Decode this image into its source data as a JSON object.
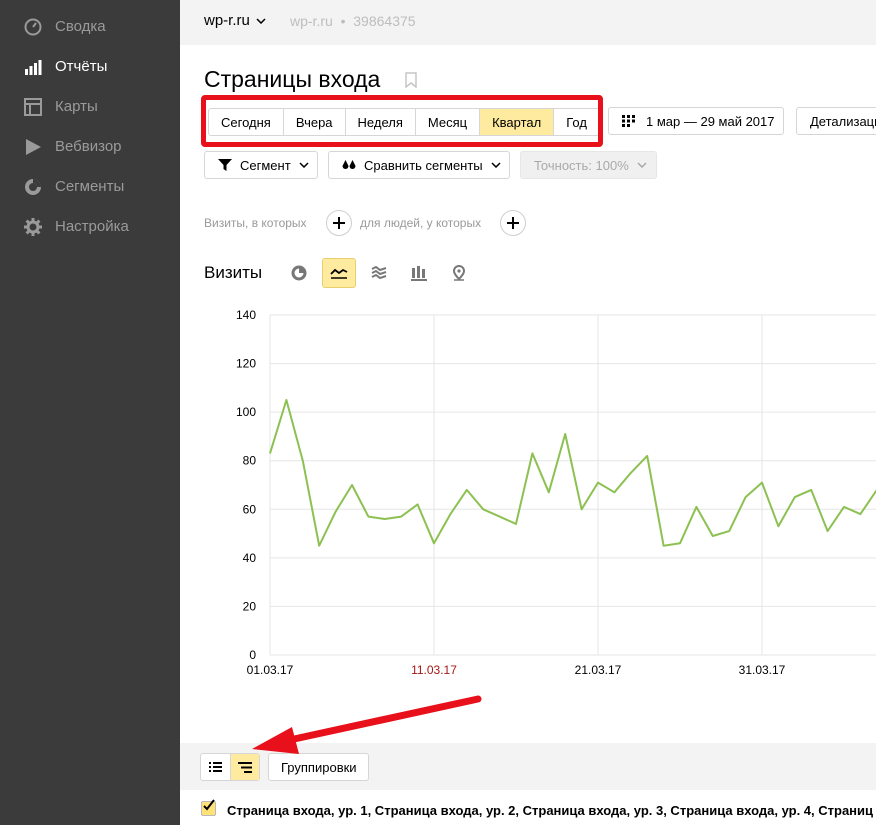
{
  "sidebar": {
    "items": [
      {
        "label": "Сводка",
        "icon": "gauge-icon",
        "active": false
      },
      {
        "label": "Отчёты",
        "icon": "bar-chart-icon",
        "active": true
      },
      {
        "label": "Карты",
        "icon": "map-layout-icon",
        "active": false
      },
      {
        "label": "Вебвизор",
        "icon": "play-icon",
        "active": false
      },
      {
        "label": "Сегменты",
        "icon": "pie-ring-icon",
        "active": false
      },
      {
        "label": "Настройка",
        "icon": "gear-icon",
        "active": false
      }
    ]
  },
  "topbar": {
    "site": "wp-r.ru",
    "site_secondary": "wp-r.ru",
    "separator": "•",
    "counter_id": "39864375"
  },
  "page": {
    "title": "Страницы входа"
  },
  "periods": {
    "items": [
      "Сегодня",
      "Вчера",
      "Неделя",
      "Месяц",
      "Квартал",
      "Год"
    ],
    "selected": "Квартал"
  },
  "toolbar": {
    "date_range": "1 мар — 29 май 2017",
    "detail": "Детализаци",
    "segment": "Сегмент",
    "compare": "Сравнить сегменты",
    "accuracy": "Точность: 100%"
  },
  "filters": {
    "visits_where": "Визиты, в которых",
    "people_where": "для людей, у которых"
  },
  "chart_section": {
    "label": "Визиты"
  },
  "chart_data": {
    "type": "line",
    "ylim": [
      0,
      140
    ],
    "yticks": [
      0,
      20,
      40,
      60,
      80,
      100,
      120,
      140
    ],
    "xticks": [
      "01.03.17",
      "11.03.17",
      "21.03.17",
      "31.03.17"
    ],
    "weekend_ticks": [
      "11.03.17"
    ],
    "series": [
      {
        "color": "#8cc152",
        "values": [
          83,
          105,
          80,
          45,
          59,
          70,
          57,
          56,
          57,
          62,
          46,
          58,
          68,
          60,
          57,
          54,
          83,
          67,
          91,
          60,
          71,
          67,
          75,
          82,
          45,
          46,
          61,
          49,
          51,
          65,
          71,
          53,
          65,
          68,
          51,
          61,
          58,
          68
        ]
      }
    ],
    "grid": true
  },
  "bottom": {
    "grouping_button": "Группировки",
    "grouping_text": "Страница входа, ур. 1, Страница входа, ур. 2, Страница входа, ур. 3, Страница входа, ур. 4, Страниц"
  },
  "colors": {
    "accent": "#ffeba0",
    "highlight": "#e8101a",
    "line": "#8cc152"
  }
}
